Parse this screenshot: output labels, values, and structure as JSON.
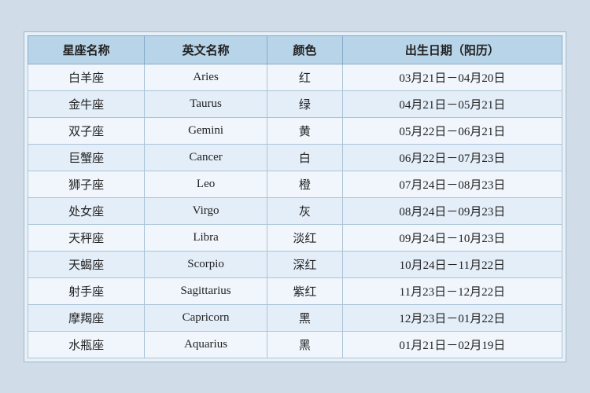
{
  "table": {
    "headers": [
      "星座名称",
      "英文名称",
      "颜色",
      "出生日期（阳历）"
    ],
    "rows": [
      {
        "zh": "白羊座",
        "en": "Aries",
        "color": "红",
        "dates": "03月21日－04月20日"
      },
      {
        "zh": "金牛座",
        "en": "Taurus",
        "color": "绿",
        "dates": "04月21日－05月21日"
      },
      {
        "zh": "双子座",
        "en": "Gemini",
        "color": "黄",
        "dates": "05月22日－06月21日"
      },
      {
        "zh": "巨蟹座",
        "en": "Cancer",
        "color": "白",
        "dates": "06月22日－07月23日"
      },
      {
        "zh": "狮子座",
        "en": "Leo",
        "color": "橙",
        "dates": "07月24日－08月23日"
      },
      {
        "zh": "处女座",
        "en": "Virgo",
        "color": "灰",
        "dates": "08月24日－09月23日"
      },
      {
        "zh": "天秤座",
        "en": "Libra",
        "color": "淡红",
        "dates": "09月24日－10月23日"
      },
      {
        "zh": "天蝎座",
        "en": "Scorpio",
        "color": "深红",
        "dates": "10月24日－11月22日"
      },
      {
        "zh": "射手座",
        "en": "Sagittarius",
        "color": "紫红",
        "dates": "11月23日－12月22日"
      },
      {
        "zh": "摩羯座",
        "en": "Capricorn",
        "color": "黑",
        "dates": "12月23日－01月22日"
      },
      {
        "zh": "水瓶座",
        "en": "Aquarius",
        "color": "黑",
        "dates": "01月21日－02月19日"
      }
    ]
  }
}
